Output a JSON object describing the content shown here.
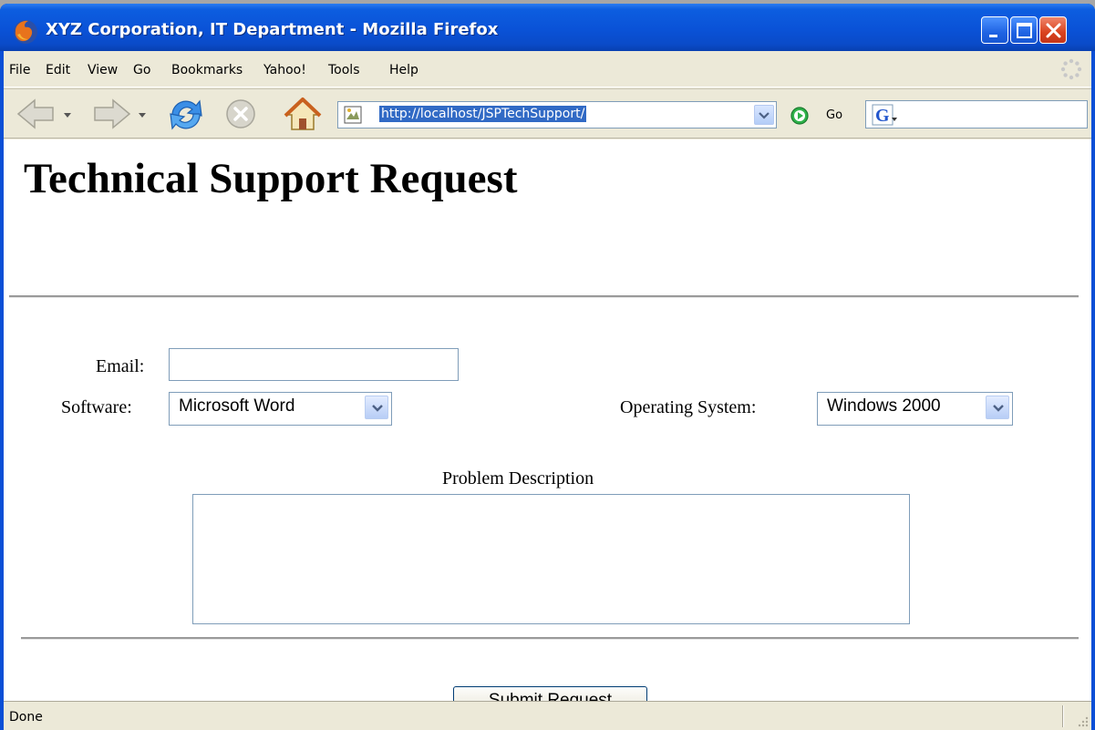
{
  "window": {
    "title": "XYZ Corporation, IT Department - Mozilla Firefox",
    "title_bar_color": "#0a52d7",
    "controls": [
      "minimize-icon",
      "maximize-icon",
      "close-icon"
    ]
  },
  "menubar": {
    "items": [
      {
        "label": "File"
      },
      {
        "label": "Edit"
      },
      {
        "label": "View"
      },
      {
        "label": "Go"
      },
      {
        "label": "Bookmarks"
      },
      {
        "label": "Yahoo!"
      },
      {
        "label": "Tools"
      },
      {
        "label": "Help"
      }
    ]
  },
  "toolbar": {
    "url": "http://localhost/JSPTechSupport/",
    "go_label": "Go",
    "search_value": "",
    "icons": [
      "back-icon",
      "forward-icon",
      "reload-icon",
      "stop-icon",
      "home-icon",
      "go-icon",
      "google-search-icon"
    ]
  },
  "page": {
    "title": "Technical Support Request",
    "email_label": "Email:",
    "email_value": "",
    "software_label": "Software:",
    "software_value": "Microsoft Word",
    "os_label": "Operating System:",
    "os_value": "Windows 2000",
    "description_label": "Problem Description",
    "description_value": "",
    "submit_label": "Submit Request"
  },
  "statusbar": {
    "text": "Done"
  }
}
